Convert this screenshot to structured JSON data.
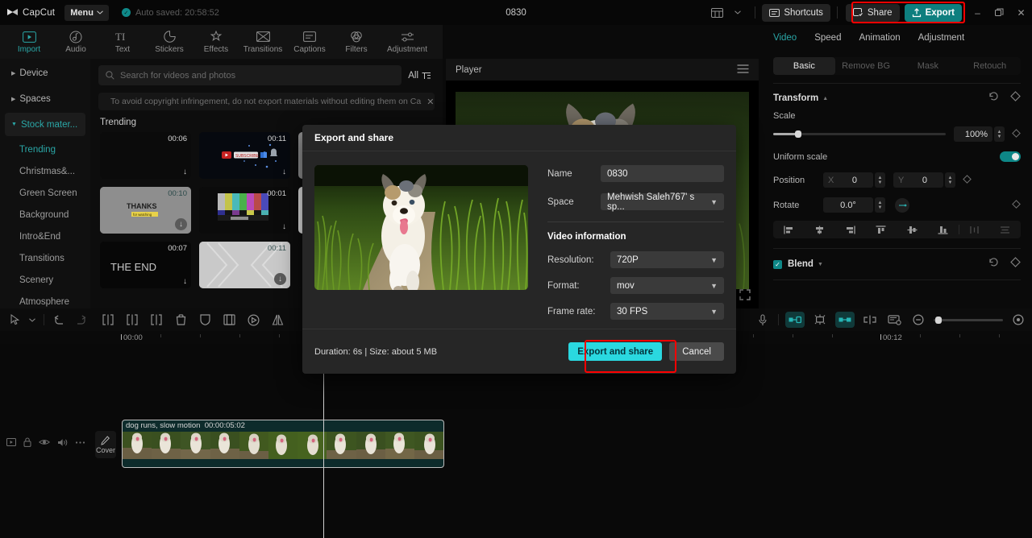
{
  "titlebar": {
    "app_name": "CapCut",
    "menu_label": "Menu",
    "autosave_text": "Auto saved: 20:58:52",
    "project_title": "0830",
    "layout_icon": "layout-icon",
    "shortcuts_label": "Shortcuts",
    "share_label": "Share",
    "export_label": "Export",
    "minimize": "–",
    "maximize": "❐",
    "close": "✕",
    "accent_teal": "#0e7f7f",
    "highlight_red": "#ff0000"
  },
  "tooltabs": [
    {
      "label": "Import",
      "icon": "import-icon",
      "active": true
    },
    {
      "label": "Audio",
      "icon": "audio-icon",
      "active": false
    },
    {
      "label": "Text",
      "icon": "text-icon",
      "active": false
    },
    {
      "label": "Stickers",
      "icon": "stickers-icon",
      "active": false
    },
    {
      "label": "Effects",
      "icon": "effects-icon",
      "active": false
    },
    {
      "label": "Transitions",
      "icon": "transitions-icon",
      "active": false
    },
    {
      "label": "Captions",
      "icon": "captions-icon",
      "active": false
    },
    {
      "label": "Filters",
      "icon": "filters-icon",
      "active": false
    },
    {
      "label": "Adjustment",
      "icon": "adjustment-icon",
      "active": false
    }
  ],
  "sidebar": {
    "groups": [
      {
        "label": "Device",
        "state": "collapsed"
      },
      {
        "label": "Spaces",
        "state": "collapsed"
      },
      {
        "label": "Stock mater...",
        "state": "expanded"
      }
    ],
    "subitems": [
      {
        "label": "Trending",
        "active": true
      },
      {
        "label": "Christmas&...",
        "active": false
      },
      {
        "label": "Green Screen",
        "active": false
      },
      {
        "label": "Background",
        "active": false
      },
      {
        "label": "Intro&End",
        "active": false
      },
      {
        "label": "Transitions",
        "active": false
      },
      {
        "label": "Scenery",
        "active": false
      },
      {
        "label": "Atmosphere",
        "active": false
      }
    ]
  },
  "media": {
    "search_placeholder": "Search for videos and photos",
    "filter_label": "All",
    "notice_text": "To avoid copyright infringement, do not export materials without editing them on Ca",
    "section_title": "Trending",
    "cards": [
      {
        "duration": "00:06",
        "kind": "dark"
      },
      {
        "duration": "00:11",
        "kind": "subscribe"
      },
      {
        "duration": "",
        "kind": "gray"
      },
      {
        "duration": "",
        "kind": "dark2"
      },
      {
        "duration": "00:10",
        "kind": "thanks",
        "caption": "THANKS",
        "subcaption": "for watching"
      },
      {
        "duration": "00:01",
        "kind": "colorbars"
      },
      {
        "duration": "",
        "kind": "white"
      },
      {
        "duration": "",
        "kind": "dark3"
      },
      {
        "duration": "00:07",
        "kind": "theend",
        "caption": "THE END"
      },
      {
        "duration": "00:11",
        "kind": "rays"
      },
      {
        "duration": "",
        "kind": "smoke"
      },
      {
        "duration": "",
        "kind": "dark4"
      }
    ]
  },
  "player": {
    "title": "Player",
    "menu_icon": "hamburger-icon",
    "fullscreen_icon": "fullscreen-icon"
  },
  "rightpanel": {
    "tabs": [
      {
        "label": "Video",
        "active": true
      },
      {
        "label": "Speed",
        "active": false
      },
      {
        "label": "Animation",
        "active": false
      },
      {
        "label": "Adjustment",
        "active": false
      }
    ],
    "segments": [
      {
        "label": "Basic",
        "active": true
      },
      {
        "label": "Remove BG",
        "active": false
      },
      {
        "label": "Mask",
        "active": false
      },
      {
        "label": "Retouch",
        "active": false
      }
    ],
    "transform": {
      "title": "Transform",
      "reset_icon": "reset-icon",
      "keyframe_icon": "keyframe-icon",
      "scale_label": "Scale",
      "scale_value": "100%",
      "scale_percent": 14,
      "uniform_label": "Uniform scale",
      "uniform_on": true,
      "position_label": "Position",
      "position_x_axis": "X",
      "position_x": "0",
      "position_y_axis": "Y",
      "position_y": "0",
      "rotate_label": "Rotate",
      "rotate_value": "0.0°"
    },
    "blend": {
      "title": "Blend",
      "checked": true
    }
  },
  "timeline": {
    "tools_left": [
      {
        "icon": "cursor-icon",
        "name": "select-tool"
      },
      {
        "icon": "chevron-down-icon",
        "name": "select-dropdown"
      },
      {
        "icon": "undo-icon",
        "name": "undo-button"
      },
      {
        "icon": "redo-icon",
        "name": "redo-button"
      },
      {
        "icon": "split-icon",
        "name": "split-button"
      },
      {
        "icon": "trim-left-icon",
        "name": "trim-left-button"
      },
      {
        "icon": "trim-right-icon",
        "name": "trim-right-button"
      },
      {
        "icon": "delete-icon",
        "name": "delete-button"
      },
      {
        "icon": "freeze-icon",
        "name": "freeze-button"
      },
      {
        "icon": "crop-icon",
        "name": "crop-button"
      },
      {
        "icon": "reverse-icon",
        "name": "reverse-button"
      },
      {
        "icon": "mirror-icon",
        "name": "mirror-button"
      }
    ],
    "tools_right": [
      {
        "icon": "mic-icon",
        "name": "record-button"
      },
      {
        "icon": "link-icon",
        "name": "link-clips-button"
      },
      {
        "icon": "magnet-icon",
        "name": "magnet-button"
      },
      {
        "icon": "adsorb-icon",
        "name": "adsorb-button"
      },
      {
        "icon": "keyframe-nav-icon",
        "name": "keyframe-nav-button"
      },
      {
        "icon": "preview-icon",
        "name": "preview-button"
      },
      {
        "icon": "zoom-out-icon",
        "name": "zoom-out-button"
      },
      {
        "icon": "zoom-in-icon",
        "name": "fit-button"
      }
    ],
    "ruler_start": "00:00",
    "ruler_mark": "00:12",
    "track_controls": [
      {
        "icon": "video-track-icon",
        "name": "track-type-icon"
      },
      {
        "icon": "lock-icon",
        "name": "lock-track-button"
      },
      {
        "icon": "eye-icon",
        "name": "hide-track-button"
      },
      {
        "icon": "volume-icon",
        "name": "mute-track-button"
      },
      {
        "icon": "more-icon",
        "name": "track-more-button"
      }
    ],
    "cover_label": "Cover",
    "clip": {
      "name": "dog runs, slow motion",
      "duration": "00:00:05:02"
    }
  },
  "dialog": {
    "title": "Export and share",
    "name_label": "Name",
    "name_value": "0830",
    "space_label": "Space",
    "space_value": "Mehwish Saleh767' s sp...",
    "video_info_title": "Video information",
    "resolution_label": "Resolution:",
    "resolution_value": "720P",
    "format_label": "Format:",
    "format_value": "mov",
    "framerate_label": "Frame rate:",
    "framerate_value": "30 FPS",
    "footer_info": "Duration: 6s | Size: about 5 MB",
    "export_button": "Export and share",
    "cancel_button": "Cancel"
  }
}
